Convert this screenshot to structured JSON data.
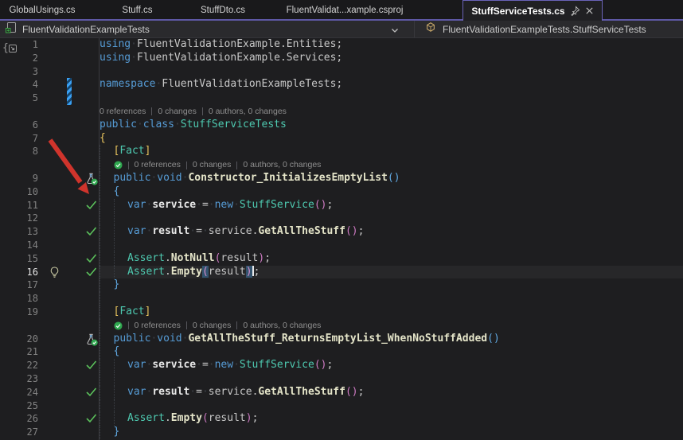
{
  "tab_bar": {
    "tabs": [
      {
        "label": "GlobalUsings.cs",
        "active": false
      },
      {
        "label": "Stuff.cs",
        "active": false
      },
      {
        "label": "StuffDto.cs",
        "active": false
      },
      {
        "label": "FluentValidat...xample.csproj",
        "active": false
      },
      {
        "label": "StuffServiceTests.cs",
        "active": true,
        "pinned": true,
        "icons": [
          "pin-icon",
          "close-icon"
        ]
      }
    ]
  },
  "breadcrumb": {
    "project_label": "FluentValidationExampleTests",
    "member_label": "FluentValidationExampleTests.StuffServiceTests",
    "icons": [
      "project-icon",
      "chevron-down-icon",
      "class-icon"
    ]
  },
  "codelens_parts": [
    "0 references",
    "0 changes",
    "0 authors, 0 changes"
  ],
  "annotation": {
    "type": "red-arrow",
    "points_at": "line-11-gutter"
  },
  "colors": {
    "accent_purple": "#5e58a5",
    "keyword_blue": "#569cd6",
    "type_teal": "#4ec9b0",
    "method_khaki": "#e5e5c9",
    "call_paren_magenta": "#cd7ac2",
    "brace_gold": "#eac55e",
    "test_pass_green": "#2fa84f",
    "gutter_check_green": "#5bc05b",
    "change_bar_blue": "#3aa0f3",
    "arrow_red": "#d0342c",
    "editor_bg": "#1e1e20"
  },
  "editor": {
    "lines": [
      {
        "n": 1,
        "ind": 0,
        "tok": [
          [
            "k",
            "using"
          ],
          [
            "w"
          ],
          [
            "f",
            "FluentValidationExample.Entities;"
          ]
        ]
      },
      {
        "n": 2,
        "ind": 0,
        "tok": [
          [
            "k",
            "using"
          ],
          [
            "w"
          ],
          [
            "f",
            "FluentValidationExample.Services;"
          ]
        ]
      },
      {
        "n": 3,
        "ind": 0,
        "tok": []
      },
      {
        "n": 4,
        "ind": 0,
        "change": true,
        "tok": [
          [
            "k",
            "namespace"
          ],
          [
            "w"
          ],
          [
            "f",
            "FluentValidationExampleTests;"
          ]
        ]
      },
      {
        "n": 5,
        "ind": 0,
        "change": true,
        "tok": []
      },
      {
        "n": 6,
        "ind": 0,
        "cl": {
          "icon": false
        },
        "tok": [
          [
            "k",
            "public"
          ],
          [
            "w"
          ],
          [
            "k",
            "class"
          ],
          [
            "w"
          ],
          [
            "t",
            "StuffServiceTests"
          ]
        ]
      },
      {
        "n": 7,
        "ind": 0,
        "tok": [
          [
            "g",
            "{"
          ]
        ]
      },
      {
        "n": 8,
        "ind": 1,
        "tok": [
          [
            "g",
            "["
          ],
          [
            "t",
            "Fact"
          ],
          [
            "g",
            "]"
          ]
        ]
      },
      {
        "n": 9,
        "ind": 1,
        "cl": {
          "icon": true
        },
        "flask": true,
        "tok": [
          [
            "k",
            "public"
          ],
          [
            "w"
          ],
          [
            "k",
            "void"
          ],
          [
            "w"
          ],
          [
            "m",
            "Constructor_InitializesEmptyList"
          ],
          [
            "b",
            "()"
          ]
        ]
      },
      {
        "n": 10,
        "ind": 1,
        "tok": [
          [
            "b",
            "{"
          ]
        ]
      },
      {
        "n": 11,
        "ind": 2,
        "check": true,
        "tok": [
          [
            "k",
            "var"
          ],
          [
            "w"
          ],
          [
            "v",
            "service"
          ],
          [
            "w"
          ],
          [
            "f",
            "="
          ],
          [
            "w"
          ],
          [
            "k",
            "new"
          ],
          [
            "w"
          ],
          [
            "t",
            "StuffService"
          ],
          [
            "p",
            "()"
          ],
          [
            "f",
            ";"
          ]
        ]
      },
      {
        "n": 12,
        "ind": 2,
        "tok": []
      },
      {
        "n": 13,
        "ind": 2,
        "check": true,
        "tok": [
          [
            "k",
            "var"
          ],
          [
            "w"
          ],
          [
            "v",
            "result"
          ],
          [
            "w"
          ],
          [
            "f",
            "="
          ],
          [
            "w"
          ],
          [
            "f",
            "service"
          ],
          [
            "f",
            "."
          ],
          [
            "m",
            "GetAllTheStuff"
          ],
          [
            "p",
            "()"
          ],
          [
            "f",
            ";"
          ]
        ]
      },
      {
        "n": 14,
        "ind": 2,
        "tok": []
      },
      {
        "n": 15,
        "ind": 2,
        "check": true,
        "tok": [
          [
            "t",
            "Assert"
          ],
          [
            "f",
            "."
          ],
          [
            "m",
            "NotNull"
          ],
          [
            "p",
            "("
          ],
          [
            "f",
            "result"
          ],
          [
            "p",
            ")"
          ],
          [
            "f",
            ";"
          ]
        ]
      },
      {
        "n": 16,
        "ind": 2,
        "check": true,
        "bulb": true,
        "current": true,
        "tok": [
          [
            "t",
            "Assert"
          ],
          [
            "f",
            "."
          ],
          [
            "m",
            "Empty"
          ],
          [
            "h",
            "("
          ],
          [
            "f",
            "result"
          ],
          [
            "h",
            ")"
          ],
          [
            "cur",
            ""
          ],
          [
            "f",
            ";"
          ]
        ]
      },
      {
        "n": 17,
        "ind": 1,
        "tok": [
          [
            "b",
            "}"
          ]
        ]
      },
      {
        "n": 18,
        "ind": 1,
        "tok": []
      },
      {
        "n": 19,
        "ind": 1,
        "tok": [
          [
            "g",
            "["
          ],
          [
            "t",
            "Fact"
          ],
          [
            "g",
            "]"
          ]
        ]
      },
      {
        "n": 20,
        "ind": 1,
        "cl": {
          "icon": true
        },
        "flask": true,
        "tok": [
          [
            "k",
            "public"
          ],
          [
            "w"
          ],
          [
            "k",
            "void"
          ],
          [
            "w"
          ],
          [
            "m",
            "GetAllTheStuff_ReturnsEmptyList_WhenNoStuffAdded"
          ],
          [
            "b",
            "()"
          ]
        ]
      },
      {
        "n": 21,
        "ind": 1,
        "tok": [
          [
            "b",
            "{"
          ]
        ]
      },
      {
        "n": 22,
        "ind": 2,
        "check": true,
        "tok": [
          [
            "k",
            "var"
          ],
          [
            "w"
          ],
          [
            "v",
            "service"
          ],
          [
            "w"
          ],
          [
            "f",
            "="
          ],
          [
            "w"
          ],
          [
            "k",
            "new"
          ],
          [
            "w"
          ],
          [
            "t",
            "StuffService"
          ],
          [
            "p",
            "()"
          ],
          [
            "f",
            ";"
          ]
        ]
      },
      {
        "n": 23,
        "ind": 2,
        "tok": []
      },
      {
        "n": 24,
        "ind": 2,
        "check": true,
        "tok": [
          [
            "k",
            "var"
          ],
          [
            "w"
          ],
          [
            "v",
            "result"
          ],
          [
            "w"
          ],
          [
            "f",
            "="
          ],
          [
            "w"
          ],
          [
            "f",
            "service"
          ],
          [
            "f",
            "."
          ],
          [
            "m",
            "GetAllTheStuff"
          ],
          [
            "p",
            "()"
          ],
          [
            "f",
            ";"
          ]
        ]
      },
      {
        "n": 25,
        "ind": 2,
        "tok": []
      },
      {
        "n": 26,
        "ind": 2,
        "check": true,
        "tok": [
          [
            "t",
            "Assert"
          ],
          [
            "f",
            "."
          ],
          [
            "m",
            "Empty"
          ],
          [
            "p",
            "("
          ],
          [
            "f",
            "result"
          ],
          [
            "p",
            ")"
          ],
          [
            "f",
            ";"
          ]
        ]
      },
      {
        "n": 27,
        "ind": 1,
        "tok": [
          [
            "b",
            "}"
          ]
        ]
      }
    ]
  }
}
